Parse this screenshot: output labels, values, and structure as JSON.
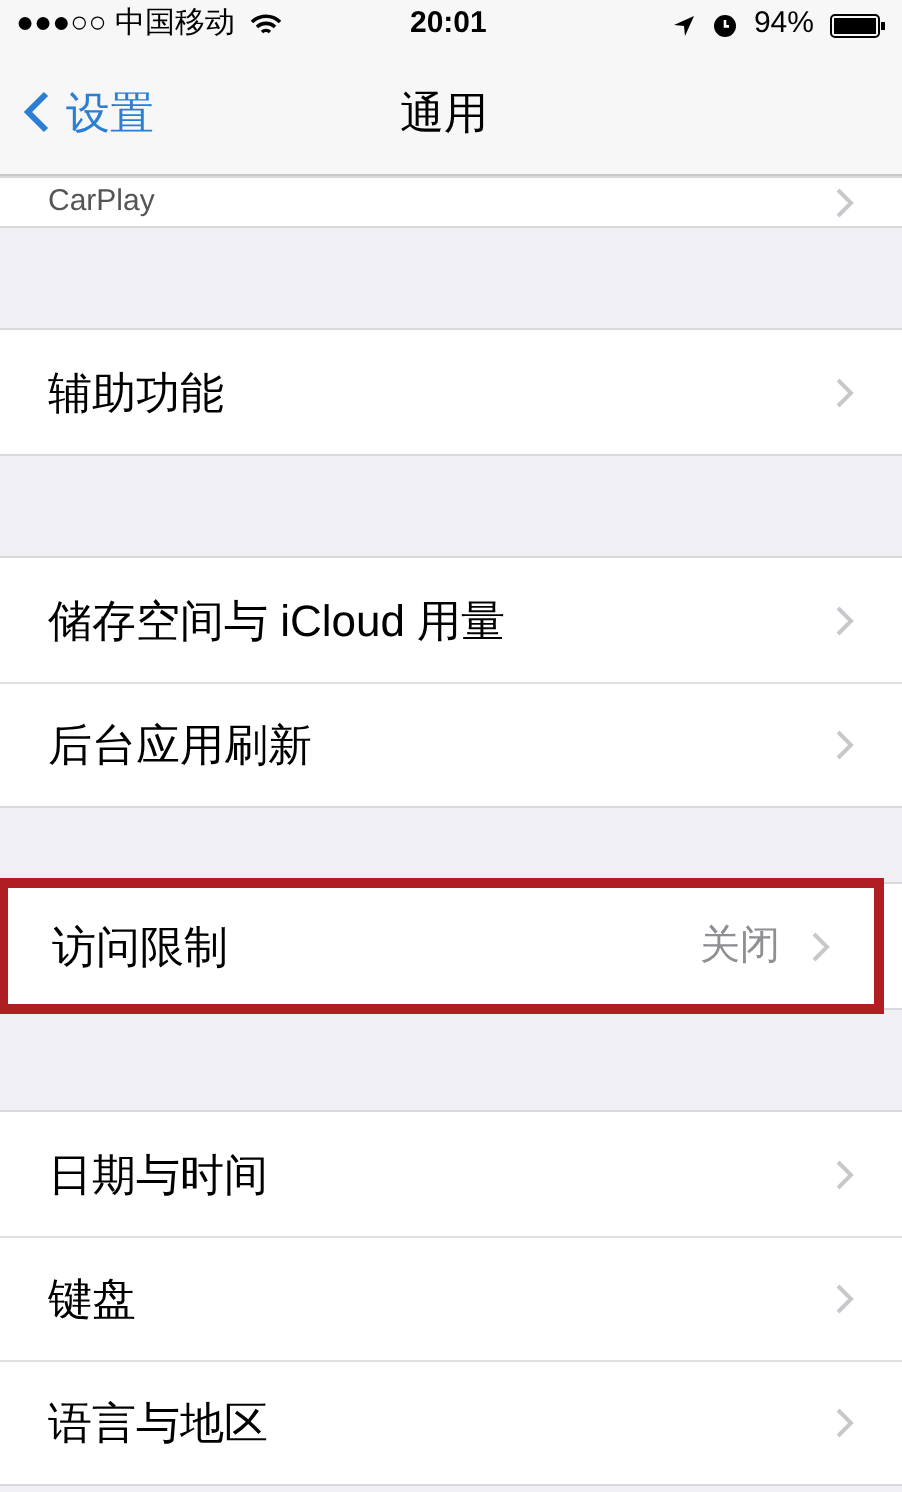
{
  "status_bar": {
    "carrier": "●●●○○ 中国移动",
    "time": "20:01",
    "battery": "94%"
  },
  "nav": {
    "back": "设置",
    "title": "通用"
  },
  "sections": [
    {
      "rows": [
        {
          "label": "CarPlay",
          "value": "",
          "highlighted": false,
          "partial": true
        }
      ]
    },
    {
      "rows": [
        {
          "label": "辅助功能",
          "value": "",
          "highlighted": false,
          "partial": false
        }
      ]
    },
    {
      "rows": [
        {
          "label": "储存空间与 iCloud 用量",
          "value": "",
          "highlighted": false,
          "partial": false
        },
        {
          "label": "后台应用刷新",
          "value": "",
          "highlighted": false,
          "partial": false
        }
      ]
    },
    {
      "rows": [
        {
          "label": "访问限制",
          "value": "关闭",
          "highlighted": true,
          "partial": false
        }
      ]
    },
    {
      "rows": [
        {
          "label": "日期与时间",
          "value": "",
          "highlighted": false,
          "partial": false
        },
        {
          "label": "键盘",
          "value": "",
          "highlighted": false,
          "partial": false
        },
        {
          "label": "语言与地区",
          "value": "",
          "highlighted": false,
          "partial": false
        }
      ]
    }
  ]
}
